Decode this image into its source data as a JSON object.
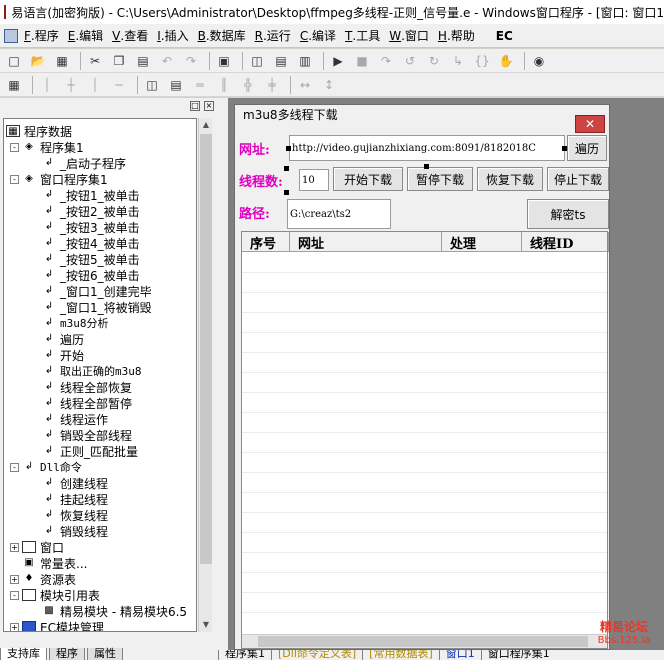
{
  "window": {
    "title": "易语言(加密狗版) - C:\\Users\\Administrator\\Desktop\\ffmpeg多线程-正则_信号量.e - Windows窗口程序 - [窗口: 窗口1"
  },
  "menu": [
    {
      "key": "F",
      "label": ".程序"
    },
    {
      "key": "E",
      "label": ".编辑"
    },
    {
      "key": "V",
      "label": ".查看"
    },
    {
      "key": "I",
      "label": ".插入"
    },
    {
      "key": "B",
      "label": ".数据库"
    },
    {
      "key": "R",
      "label": ".运行"
    },
    {
      "key": "C",
      "label": ".编译"
    },
    {
      "key": "T",
      "label": ".工具"
    },
    {
      "key": "W",
      "label": ".窗口"
    },
    {
      "key": "H",
      "label": ".帮助"
    }
  ],
  "menu_badge": "EC",
  "tree": {
    "root": "程序数据",
    "items": [
      {
        "label": "程序集1"
      },
      {
        "label": "_启动子程序"
      },
      {
        "label": "窗口程序集1"
      },
      {
        "label": "_按钮1_被单击"
      },
      {
        "label": "_按钮2_被单击"
      },
      {
        "label": "_按钮3_被单击"
      },
      {
        "label": "_按钮4_被单击"
      },
      {
        "label": "_按钮5_被单击"
      },
      {
        "label": "_按钮6_被单击"
      },
      {
        "label": "_窗口1_创建完毕"
      },
      {
        "label": "_窗口1_将被销毁"
      },
      {
        "label": "m3u8分析"
      },
      {
        "label": "遍历"
      },
      {
        "label": "开始"
      },
      {
        "label": "取出正确的m3u8"
      },
      {
        "label": "线程全部恢复"
      },
      {
        "label": "线程全部暂停"
      },
      {
        "label": "线程运作"
      },
      {
        "label": "销毁全部线程"
      },
      {
        "label": "正则_匹配批量"
      },
      {
        "label": "Dll命令"
      },
      {
        "label": "创建线程"
      },
      {
        "label": "挂起线程"
      },
      {
        "label": "恢复线程"
      },
      {
        "label": "销毁线程"
      },
      {
        "label": "窗口"
      },
      {
        "label": "常量表..."
      },
      {
        "label": "资源表"
      },
      {
        "label": "模块引用表"
      },
      {
        "label": "精易模块 - 精易模块6.5"
      },
      {
        "label": "EC模块管理"
      }
    ]
  },
  "left_tabs": [
    "支持库",
    "程序",
    "属性"
  ],
  "form": {
    "title": "m3u8多线程下载",
    "url_label": "网址:",
    "url_value": "http://video.gujianzhixiang.com:8091/8182018C",
    "browse_button": "遍历",
    "threads_label": "线程数:",
    "threads_value": "10",
    "start_button": "开始下载",
    "pause_button": "暂停下载",
    "resume_button": "恢复下载",
    "stop_button": "停止下载",
    "path_label": "路径:",
    "path_value": "G:\\creaz\\ts2",
    "decrypt_button": "解密ts",
    "columns": [
      "序号",
      "网址",
      "处理",
      "线程ID"
    ]
  },
  "bottom_tabs": [
    {
      "label": "程序集1"
    },
    {
      "label": "[Dll命令定义表]"
    },
    {
      "label": "[常用数据表]"
    },
    {
      "label": "窗口1"
    },
    {
      "label": "窗口程序集1"
    }
  ],
  "watermark": {
    "line1": "精易论坛",
    "line2": "Bbs.125.la"
  }
}
